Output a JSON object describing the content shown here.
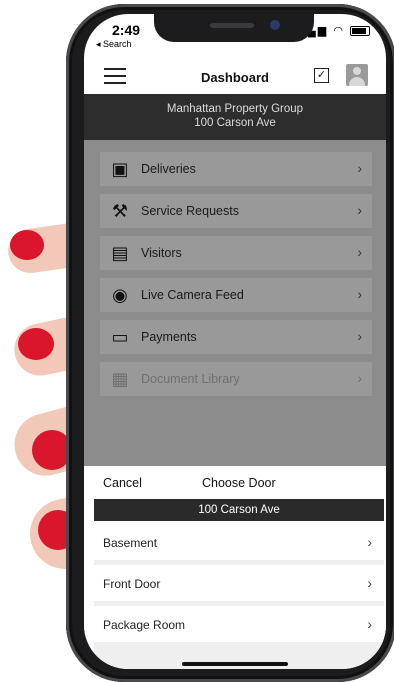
{
  "status_bar": {
    "time": "2:49",
    "back_label": "◂ Search",
    "signal": "▂▄▆",
    "wifi": "◠"
  },
  "navbar": {
    "title": "Dashboard",
    "menu_icon": "hamburger-icon",
    "check_icon": "checkbox-icon",
    "profile_icon": "avatar-icon"
  },
  "property": {
    "name": "Manhattan Property Group",
    "address": "100 Carson Ave"
  },
  "menu": [
    {
      "label": "Deliveries",
      "icon": "package-icon",
      "glyph": "▣",
      "enabled": true
    },
    {
      "label": "Service Requests",
      "icon": "hammer-icon",
      "glyph": "⚒",
      "enabled": true
    },
    {
      "label": "Visitors",
      "icon": "id-card-icon",
      "glyph": "▤",
      "enabled": true
    },
    {
      "label": "Live Camera Feed",
      "icon": "camera-icon",
      "glyph": "◉",
      "enabled": true
    },
    {
      "label": "Payments",
      "icon": "credit-card-icon",
      "glyph": "▭",
      "enabled": true
    },
    {
      "label": "Document Library",
      "icon": "document-icon",
      "glyph": "▦",
      "enabled": false
    }
  ],
  "chevron": "›",
  "sheet": {
    "cancel_label": "Cancel",
    "title": "Choose Door",
    "building": "100 Carson Ave",
    "doors": [
      {
        "label": "Basement"
      },
      {
        "label": "Front Door"
      },
      {
        "label": "Package Room"
      }
    ]
  },
  "colors": {
    "accent_dark": "#2d2d2d",
    "overlay_gray": "#8c8c8c",
    "nail_red": "#d9162c"
  }
}
